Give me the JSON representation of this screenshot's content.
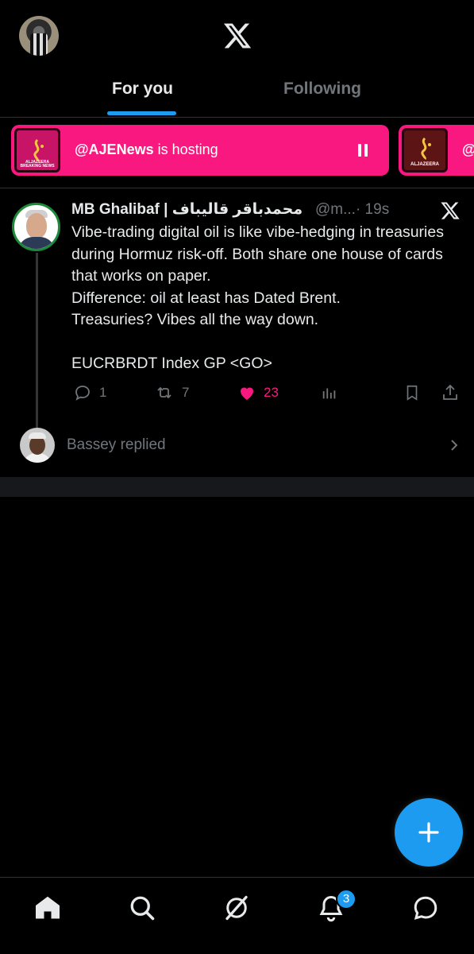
{
  "header": {
    "logo_icon": "x-logo-icon",
    "tabs": [
      {
        "label": "For you",
        "active": true
      },
      {
        "label": "Following",
        "active": false
      }
    ]
  },
  "spaces": [
    {
      "host": "@AJENews",
      "suffix": " is hosting",
      "thumb_label": "ALJAZEERA BREAKING NEWS"
    },
    {
      "host": "@",
      "thumb_label": "ALJAZEERA"
    }
  ],
  "post": {
    "author_name": "MB Ghalibaf | محمدباقر قالیباف",
    "handle": "@m...",
    "time": "· 19s",
    "text": "Vibe-trading digital oil is like vibe-hedging in treasuries during Hormuz risk-off. Both share one house of cards that works on paper.\nDifference: oil at least has Dated Brent.\nTreasuries? Vibes all the way down.\n\nEUCRBRDT Index GP <GO>",
    "actions": {
      "replies": "1",
      "reposts": "7",
      "likes": "23"
    }
  },
  "reply_row": {
    "text": "Bassey replied"
  },
  "bottom_nav": {
    "notifications_badge": "3",
    "items": [
      "home-icon",
      "search-icon",
      "grok-icon",
      "notifications-icon",
      "messages-icon"
    ]
  },
  "colors": {
    "accent": "#1d9bf0",
    "spaces_pink": "#f91880",
    "like_pink": "#f91880",
    "muted_text": "#71767b"
  }
}
